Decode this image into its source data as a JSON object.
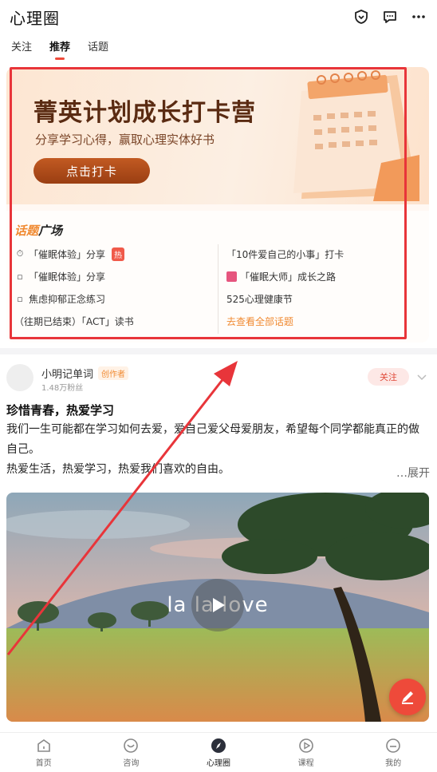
{
  "header": {
    "title": "心理圈"
  },
  "tabs": [
    {
      "label": "关注"
    },
    {
      "label": "推荐"
    },
    {
      "label": "话题"
    }
  ],
  "banner": {
    "title": "菁英计划成长打卡营",
    "subtitle": "分享学习心得，赢取心理实体好书",
    "button_label": "点击打卡"
  },
  "topics": {
    "heading_highlight": "话题",
    "heading_rest": "广场",
    "left": [
      {
        "label": "「催眠体验」分享",
        "badge": "热"
      },
      {
        "label": "「催眠体验」分享"
      },
      {
        "label": "焦虑抑郁正念练习"
      },
      {
        "label": "（往期已结束）「ACT」读书"
      }
    ],
    "right": [
      {
        "label": "「10件爱自己的小事」打卡"
      },
      {
        "label": "「催眠大师」成长之路"
      },
      {
        "label": "525心理健康节"
      },
      {
        "label": "去查看全部话题"
      }
    ]
  },
  "post": {
    "author": "小明记单词",
    "author_badge": "创作者",
    "fans": "1.48万粉丝",
    "follow_label": "关注",
    "title": "珍惜青春，热爱学习",
    "body_line1": "我们一生可能都在学习如何去爱，爱自己爱父母爱朋友，希望每个同学都能真正的做自己。",
    "body_line2": "热爱生活，热爱学习，热爱我们喜欢的自由。",
    "expand_label": "…展开",
    "video_caption": "la la love"
  },
  "bottom_nav": [
    {
      "label": "首页"
    },
    {
      "label": "咨询"
    },
    {
      "label": "心理圈"
    },
    {
      "label": "课程"
    },
    {
      "label": "我的"
    }
  ],
  "colors": {
    "accent": "#ee4a3a",
    "topic_highlight": "#f08a32",
    "annotation_red": "#e8353a"
  }
}
